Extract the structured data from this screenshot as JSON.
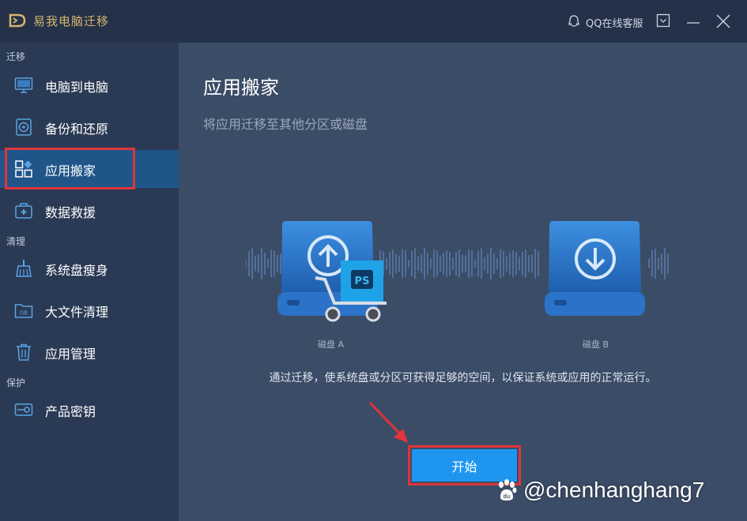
{
  "titlebar": {
    "app_name": "易我电脑迁移",
    "support_label": "QQ在线客服",
    "icons": [
      "logo-icon",
      "qq-icon",
      "menu-icon",
      "minimize-icon",
      "close-icon"
    ]
  },
  "sidebar": {
    "sections": [
      {
        "label": "迁移",
        "items": [
          {
            "label": "电脑到电脑",
            "icon": "monitor-icon"
          },
          {
            "label": "备份和还原",
            "icon": "backup-icon"
          },
          {
            "label": "应用搬家",
            "icon": "apps-icon",
            "active": true
          },
          {
            "label": "数据救援",
            "icon": "rescue-kit-icon"
          }
        ]
      },
      {
        "label": "清理",
        "items": [
          {
            "label": "系统盘瘦身",
            "icon": "broom-icon"
          },
          {
            "label": "大文件清理",
            "icon": "folder-gb-icon"
          },
          {
            "label": "应用管理",
            "icon": "trash-icon"
          }
        ]
      },
      {
        "label": "保护",
        "items": [
          {
            "label": "产品密钥",
            "icon": "key-icon"
          }
        ]
      }
    ]
  },
  "main": {
    "title": "应用搬家",
    "subtitle": "将应用迁移至其他分区或磁盘",
    "disk_a_label": "磁盘 A",
    "disk_b_label": "磁盘 B",
    "ps_badge": "PS",
    "description": "通过迁移，使系统盘或分区可获得足够的空间，以保证系统或应用的正常运行。",
    "start_button": "开始",
    "watermark": "@chenhanghang7"
  },
  "colors": {
    "titlebar_bg": "#243149",
    "sidebar_bg": "#2a3a54",
    "main_bg": "#3b4c67",
    "active_item_bg": "#20558a",
    "brand_gold": "#d7b56d",
    "accent_blue": "#1e96f0",
    "highlight_red": "#e0353a"
  }
}
